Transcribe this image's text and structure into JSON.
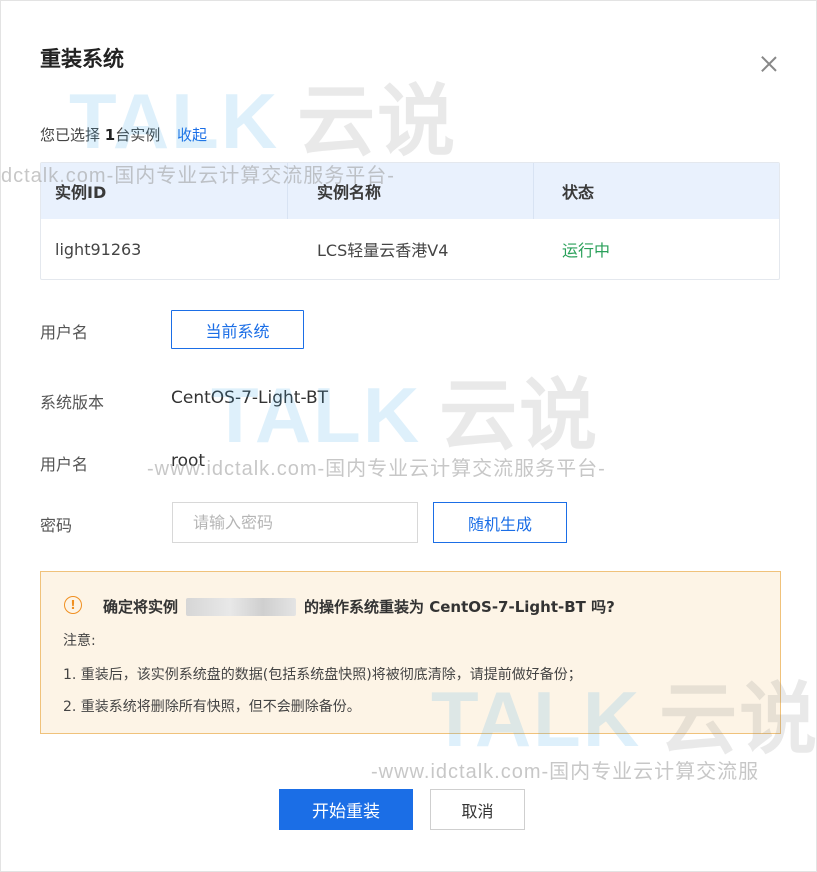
{
  "dialog": {
    "title": "重装系统",
    "close_icon": "close-icon"
  },
  "selection": {
    "prefix": "您已选择",
    "count": "1",
    "suffix": "台实例",
    "collapse_label": "收起"
  },
  "table": {
    "headers": [
      "实例ID",
      "实例名称",
      "状态"
    ],
    "rows": [
      {
        "id": "light91263",
        "name": "LCS轻量云香港V4",
        "status": "运行中"
      }
    ]
  },
  "form": {
    "current_system": {
      "label": "用户名",
      "button": "当前系统"
    },
    "os_version": {
      "label": "系统版本",
      "value": "CentOS-7-Light-BT"
    },
    "username": {
      "label": "用户名",
      "value": "root"
    },
    "password": {
      "label": "密码",
      "placeholder": "请输入密码",
      "value": "",
      "random_button": "随机生成"
    }
  },
  "warning": {
    "icon": "alert-circle-icon",
    "main_prefix": "确定将实例",
    "main_suffix": "的操作系统重装为 CentOS-7-Light-BT 吗?",
    "note_title": "注意:",
    "notes": [
      "1. 重装后，该实例系统盘的数据(包括系统盘快照)将被彻底清除，请提前做好备份；",
      "2. 重装系统将删除所有快照，但不会删除备份。"
    ]
  },
  "actions": {
    "start_label": "开始重装",
    "cancel_label": "取消"
  },
  "watermark": {
    "logo_text": "TALK",
    "logo_cn": "云说",
    "subtitle_1": "dctalk.com-国内专业云计算交流服务平台-",
    "subtitle_2": "-www.idctalk.com-国内专业云计算交流服务平台-",
    "subtitle_3": "-www.idctalk.com-国内专业云计算交流服"
  },
  "colors": {
    "primary": "#1b6ee6",
    "running": "#2aa05a",
    "warning_bg": "#fdf4e6",
    "warning_border": "#f0c27b",
    "warning_icon": "#f09022"
  }
}
